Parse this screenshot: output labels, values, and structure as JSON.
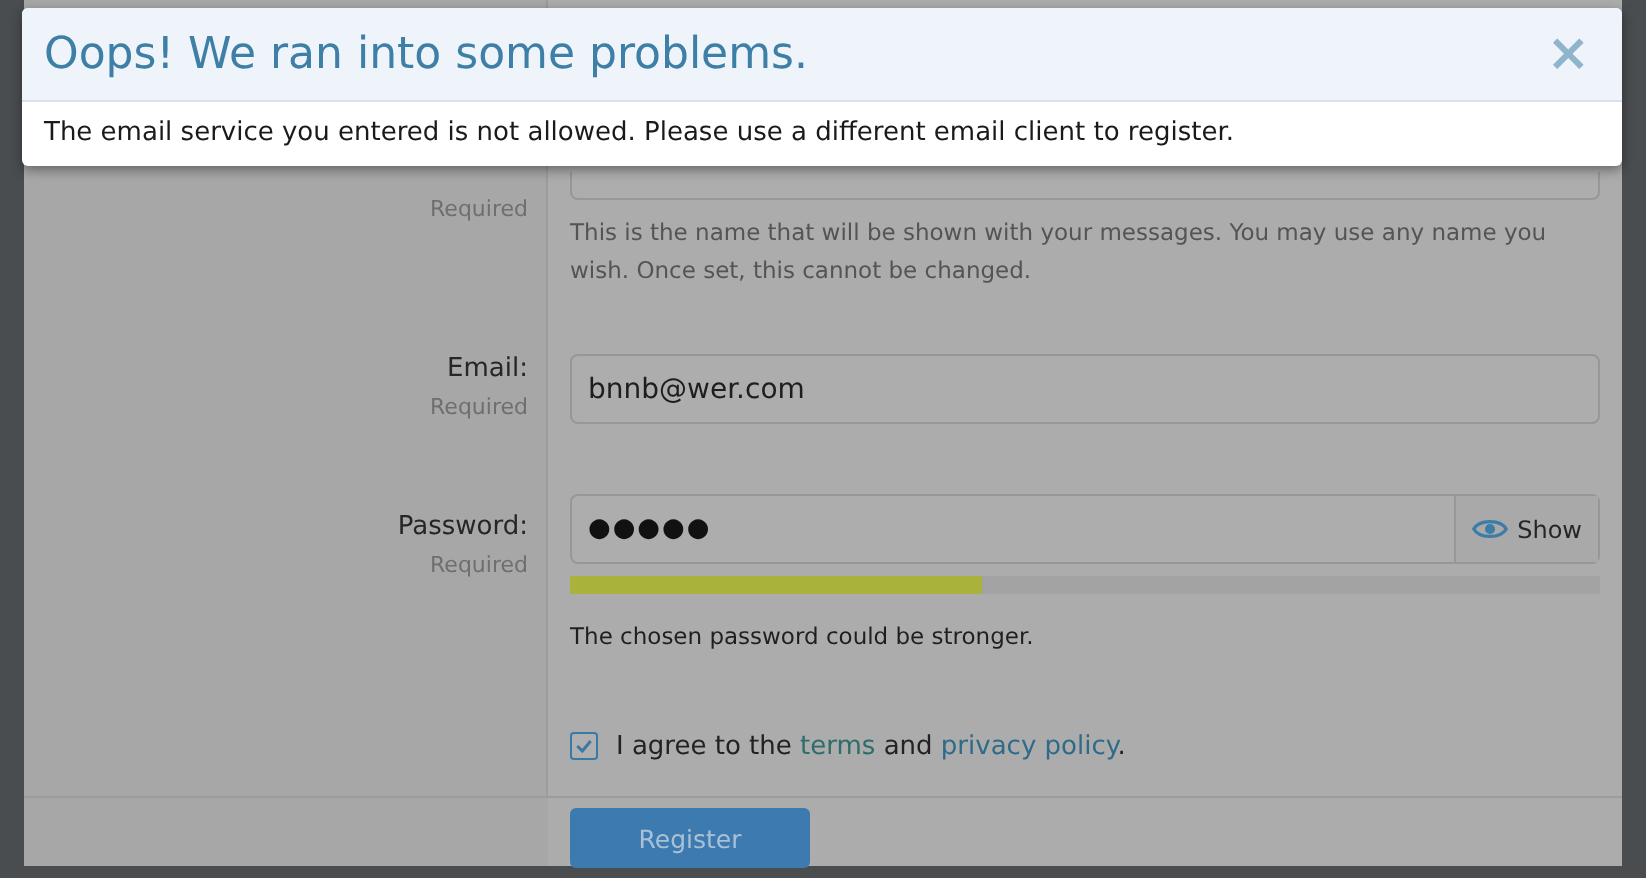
{
  "alert": {
    "title": "Oops! We ran into some problems.",
    "close": "×",
    "message": "The email service you entered is not allowed. Please use a different email client to register."
  },
  "form": {
    "rows": [
      {
        "kind": "text",
        "required": "Required",
        "hint": "This is the name that will be shown with your messages. You may use any name you wish. Once set, this cannot be changed."
      },
      {
        "kind": "text",
        "label": "Email:",
        "required": "Required",
        "value": "bnnb@wer.com"
      },
      {
        "kind": "password",
        "label": "Password:",
        "required": "Required",
        "value": "●●●●●",
        "show": "Show",
        "level": 0.4,
        "hint": "The chosen password could be stronger."
      },
      {
        "kind": "agree",
        "checked": true,
        "text": "I agree to the ",
        "terms": "terms",
        "and": " and ",
        "privacy": "privacy policy",
        "end": "."
      }
    ],
    "submit": "Register"
  }
}
